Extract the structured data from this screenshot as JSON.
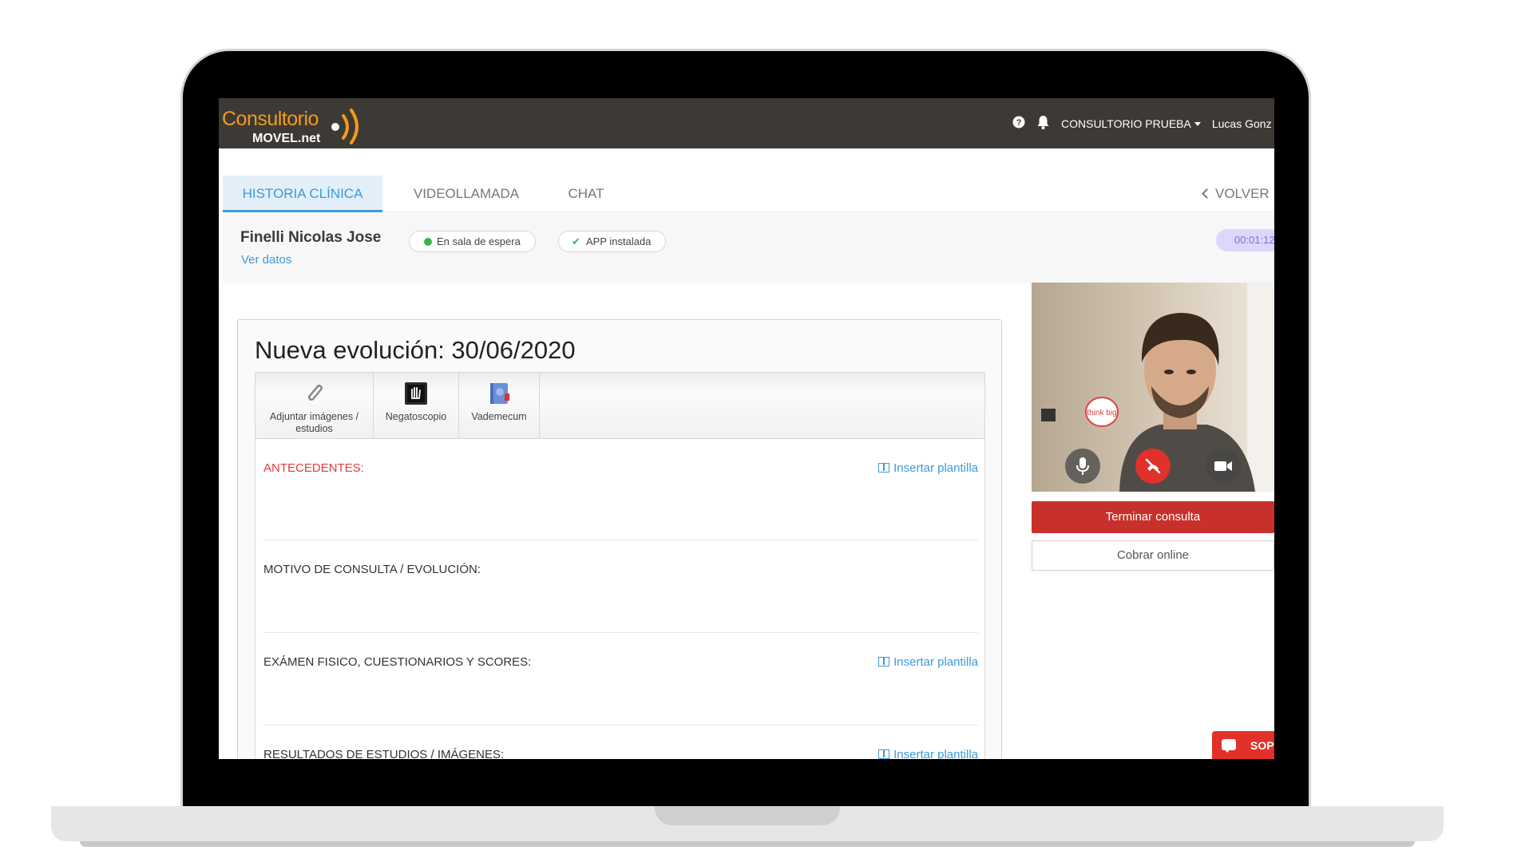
{
  "app": {
    "logo_main": "Consultorio",
    "logo_sub": "MOVEL.net"
  },
  "topbar": {
    "help_icon": "question-circle-icon",
    "bell_icon": "bell-icon",
    "workspace": "CONSULTORIO PRUEBA",
    "user": "Lucas Gonz"
  },
  "tabs": [
    {
      "label": "HISTORIA CLÍNICA",
      "active": true
    },
    {
      "label": "VIDEOLLAMADA",
      "active": false
    },
    {
      "label": "CHAT",
      "active": false
    }
  ],
  "back_label": "VOLVER",
  "patient": {
    "name": "Finelli Nicolas Jose",
    "view_data": "Ver datos",
    "status_waiting": "En sala de espera",
    "status_app": "APP instalada",
    "timer": "00:01:12"
  },
  "evolution": {
    "title": "Nueva evolución: 30/06/2020",
    "tools": [
      {
        "label": "Adjuntar imágenes / estudios",
        "icon": "paperclip-icon"
      },
      {
        "label": "Negatoscopio",
        "icon": "xray-icon"
      },
      {
        "label": "Vademecum",
        "icon": "book-icon"
      }
    ],
    "sections": [
      {
        "label": "ANTECEDENTES:",
        "insert": "Insertar plantilla"
      },
      {
        "label": "MOTIVO DE CONSULTA / EVOLUCIÓN:",
        "insert": ""
      },
      {
        "label": "EXÁMEN FISICO, CUESTIONARIOS Y SCORES:",
        "insert": "Insertar plantilla"
      },
      {
        "label": "RESULTADOS DE ESTUDIOS / IMÁGENES:",
        "insert": "Insertar plantilla"
      }
    ]
  },
  "call": {
    "end_label": "Terminar consulta",
    "pay_label": "Cobrar online",
    "mic_icon": "microphone-icon",
    "hangup_icon": "phone-hangup-icon",
    "camera_icon": "camera-icon"
  },
  "support_label": "SOP",
  "colors": {
    "topbar_bg": "#3d3a36",
    "accent_blue": "#3d9ad8",
    "logo_orange": "#f39a1e",
    "danger_red": "#c8312b",
    "status_green": "#3bb54a",
    "timer_purple": "#7a6fe0"
  }
}
